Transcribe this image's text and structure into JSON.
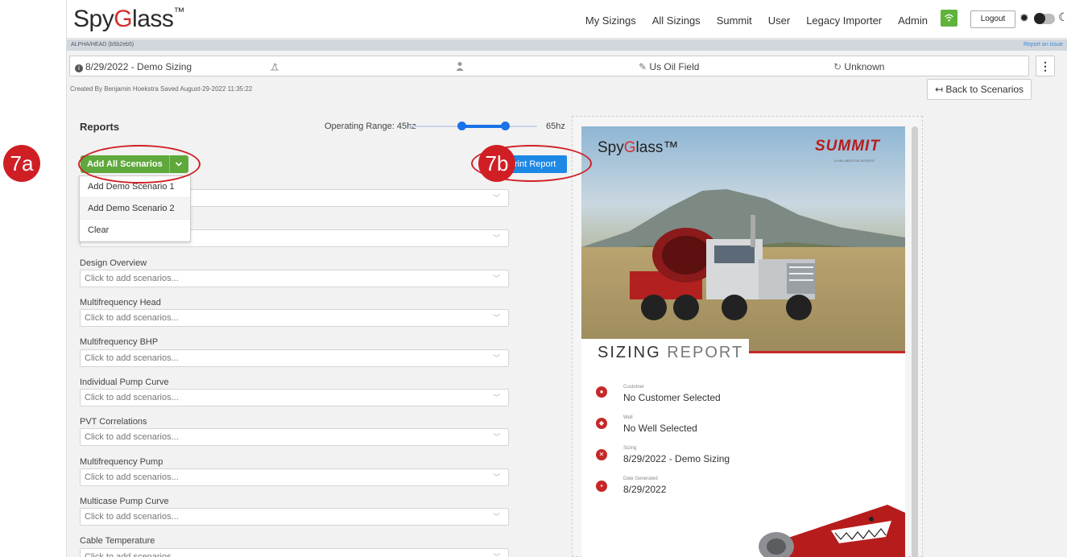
{
  "app": {
    "logo": "SpyGlass",
    "logo_pre": "Spy",
    "logo_g": "G",
    "logo_post": "lass",
    "logo_tm": "™"
  },
  "nav": {
    "items": [
      "My Sizings",
      "All Sizings",
      "Summit",
      "User",
      "Legacy Importer",
      "Admin"
    ],
    "logout": "Logout"
  },
  "alpha": {
    "left": "ALPHA/HEAD (b5b2eb5)",
    "right": "Report an issue"
  },
  "sizing_bar": {
    "name": "8/29/2022 - Demo Sizing",
    "field": "Us Oil Field",
    "status": "Unknown"
  },
  "meta": {
    "created": "Created By Benjamin Hoekstra    Saved August-29-2022 11:35:22",
    "back": "↤ Back to Scenarios"
  },
  "reports": {
    "title": "Reports",
    "operating_range_label": "Operating Range: 45hz",
    "max_label": "65hz",
    "add_all": "Add All Scenarios",
    "print": "Print Report",
    "menu": [
      "Add Demo Scenario 1",
      "Add Demo Scenario 2",
      "Clear"
    ],
    "placeholder": "Click to add scenarios...",
    "sections": [
      "Design Overview",
      "Multifrequency Head",
      "Multifrequency BHP",
      "Individual Pump Curve",
      "PVT Correlations",
      "Multifrequency Pump",
      "Multicase Pump Curve",
      "Cable Temperature"
    ]
  },
  "preview": {
    "brand_left_pre": "Spy",
    "brand_left_g": "G",
    "brand_left_post": "lass™",
    "brand_right": "SUMMIT",
    "brand_sub": "A HALLIBURTON SERVICE",
    "sizing_title_bold": "SIZING",
    "sizing_title_light": "REPORT",
    "items": [
      {
        "label": "Customer",
        "value": "No Customer Selected"
      },
      {
        "label": "Well",
        "value": "No Well Selected"
      },
      {
        "label": "Sizing",
        "value": "8/29/2022 - Demo Sizing"
      },
      {
        "label": "Date Generated",
        "value": "8/29/2022"
      }
    ]
  },
  "annotations": {
    "a": "7a",
    "b": "7b"
  },
  "colors": {
    "accent_red": "#cf1f25",
    "green": "#5fa83c",
    "blue": "#1e88e5"
  }
}
